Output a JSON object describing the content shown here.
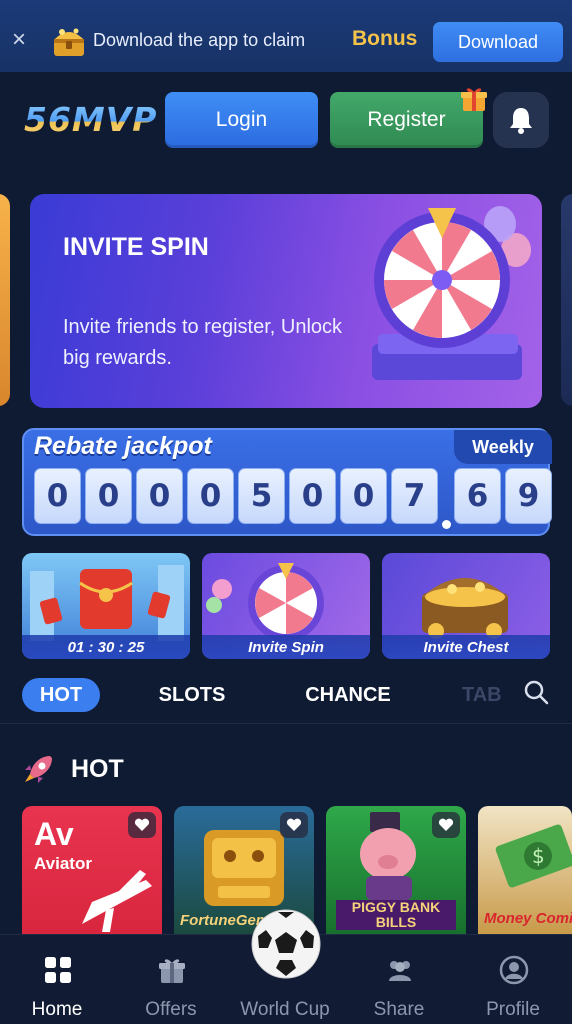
{
  "app_banner": {
    "close_icon": "close-icon",
    "text": "Download the app to claim",
    "bonus": "Bonus",
    "download_label": "Download"
  },
  "header": {
    "logo": "56MVP",
    "login_label": "Login",
    "register_label": "Register"
  },
  "hero": {
    "title": "INVITE SPIN",
    "subtitle": "Invite friends to register, Unlock big rewards."
  },
  "jackpot": {
    "title": "Rebate jackpot",
    "period": "Weekly",
    "digits": [
      "0",
      "0",
      "0",
      "0",
      "5",
      "0",
      "0",
      "7",
      "6",
      "9"
    ],
    "value": "00005007.69"
  },
  "promos": [
    {
      "caption": "01 : 30 : 25"
    },
    {
      "caption": "Invite Spin"
    },
    {
      "caption": "Invite Chest"
    }
  ],
  "tabs": [
    {
      "label": "HOT"
    },
    {
      "label": "SLOTS"
    },
    {
      "label": "CHANCE"
    },
    {
      "label": "TAB"
    }
  ],
  "hot_section": {
    "title": "HOT",
    "games": [
      {
        "title": "Av",
        "subtitle": "Aviator"
      },
      {
        "title": "FortuneGems"
      },
      {
        "title": "PIGGY BANK BILLS"
      },
      {
        "title": "Money Coming"
      }
    ]
  },
  "bottom_nav": [
    {
      "label": "Home",
      "icon": "home-icon"
    },
    {
      "label": "Offers",
      "icon": "gift-icon"
    },
    {
      "label": "World Cup",
      "icon": "soccer-ball-icon"
    },
    {
      "label": "Share",
      "icon": "users-icon"
    },
    {
      "label": "Profile",
      "icon": "profile-icon"
    }
  ],
  "colors": {
    "background": "#0f1a33",
    "accent_blue": "#3a7ef0",
    "register_green": "#3a9a5e",
    "bonus_gold": "#f5c34a"
  }
}
